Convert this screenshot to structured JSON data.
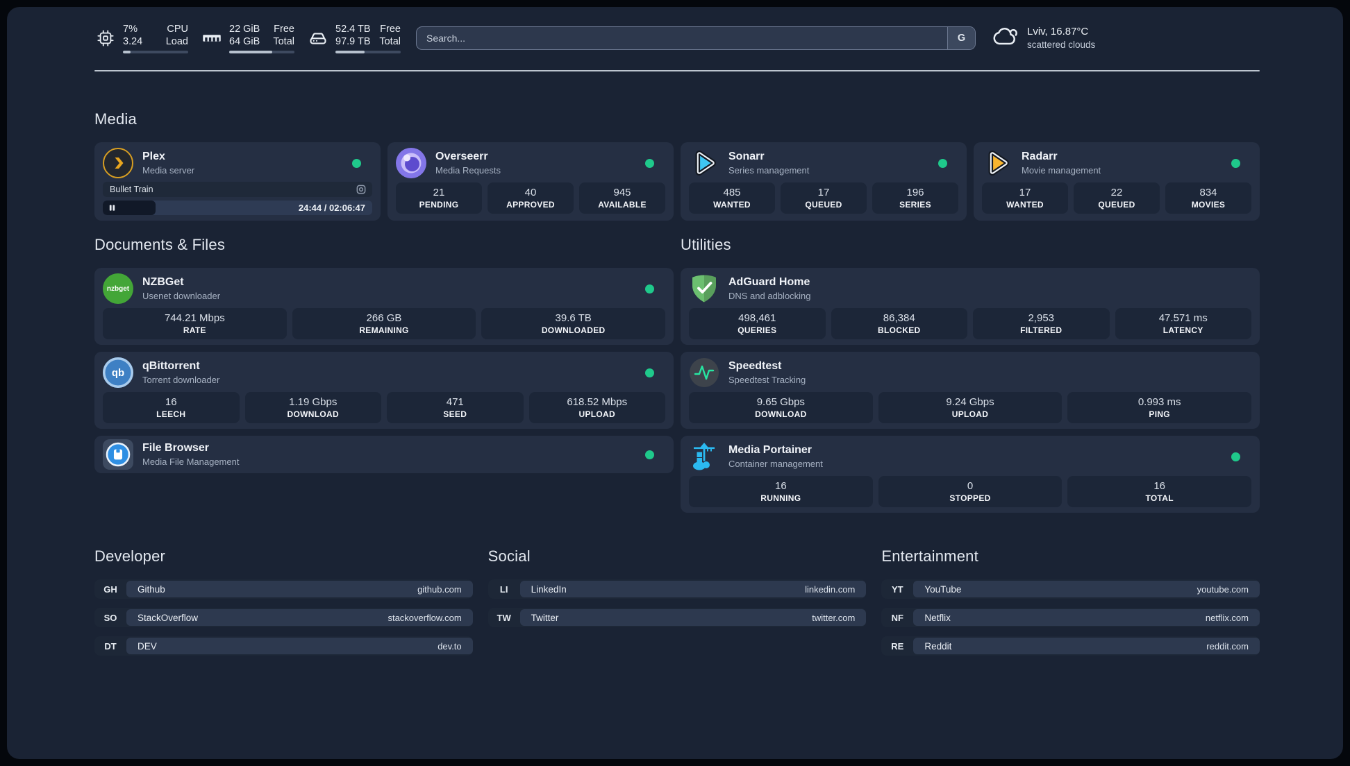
{
  "colors": {
    "status_online": "#1FC98B",
    "accent_cloud_blue": "#2BB9F0"
  },
  "header": {
    "stats": [
      {
        "icon": "cpu-icon",
        "value1": "7%",
        "label1": "CPU",
        "value2": "3.24",
        "label2": "Load",
        "progress_pct": 12
      },
      {
        "icon": "ram-icon",
        "value1": "22 GiB",
        "label1": "Free",
        "value2": "64 GiB",
        "label2": "Total",
        "progress_pct": 66
      },
      {
        "icon": "disk-icon",
        "value1": "52.4 TB",
        "label1": "Free",
        "value2": "97.9 TB",
        "label2": "Total",
        "progress_pct": 45
      }
    ],
    "search": {
      "placeholder": "Search...",
      "engine_label": "G"
    },
    "weather": {
      "icon": "cloud-icon",
      "location": "Lviv, 16.87°C",
      "condition": "scattered clouds"
    }
  },
  "media": {
    "title": "Media",
    "plex": {
      "name": "Plex",
      "subtitle": "Media server",
      "status": "online",
      "now_playing": {
        "title": "Bullet Train",
        "time": "24:44 / 02:06:47",
        "progress_pct": 19.5
      }
    },
    "overseerr": {
      "name": "Overseerr",
      "subtitle": "Media Requests",
      "status": "online",
      "stats": [
        {
          "value": "21",
          "label": "PENDING"
        },
        {
          "value": "40",
          "label": "APPROVED"
        },
        {
          "value": "945",
          "label": "AVAILABLE"
        }
      ]
    },
    "sonarr": {
      "name": "Sonarr",
      "subtitle": "Series management",
      "status": "online",
      "stats": [
        {
          "value": "485",
          "label": "WANTED"
        },
        {
          "value": "17",
          "label": "QUEUED"
        },
        {
          "value": "196",
          "label": "SERIES"
        }
      ]
    },
    "radarr": {
      "name": "Radarr",
      "subtitle": "Movie management",
      "status": "online",
      "stats": [
        {
          "value": "17",
          "label": "WANTED"
        },
        {
          "value": "22",
          "label": "QUEUED"
        },
        {
          "value": "834",
          "label": "MOVIES"
        }
      ]
    }
  },
  "documents": {
    "title": "Documents & Files",
    "nzbget": {
      "name": "NZBGet",
      "subtitle": "Usenet downloader",
      "icon_label": "nzbget",
      "status": "online",
      "stats": [
        {
          "value": "744.21 Mbps",
          "label": "RATE"
        },
        {
          "value": "266 GB",
          "label": "REMAINING"
        },
        {
          "value": "39.6 TB",
          "label": "DOWNLOADED"
        }
      ]
    },
    "qbittorrent": {
      "name": "qBittorrent",
      "subtitle": "Torrent downloader",
      "icon_label": "qb",
      "status": "online",
      "stats": [
        {
          "value": "16",
          "label": "LEECH"
        },
        {
          "value": "1.19 Gbps",
          "label": "DOWNLOAD"
        },
        {
          "value": "471",
          "label": "SEED"
        },
        {
          "value": "618.52 Mbps",
          "label": "UPLOAD"
        }
      ]
    },
    "filebrowser": {
      "name": "File Browser",
      "subtitle": "Media File Management",
      "status": "online"
    }
  },
  "utilities": {
    "title": "Utilities",
    "adguard": {
      "name": "AdGuard Home",
      "subtitle": "DNS and adblocking",
      "stats": [
        {
          "value": "498,461",
          "label": "QUERIES"
        },
        {
          "value": "86,384",
          "label": "BLOCKED"
        },
        {
          "value": "2,953",
          "label": "FILTERED"
        },
        {
          "value": "47.571 ms",
          "label": "LATENCY"
        }
      ]
    },
    "speedtest": {
      "name": "Speedtest",
      "subtitle": "Speedtest Tracking",
      "stats": [
        {
          "value": "9.65 Gbps",
          "label": "DOWNLOAD"
        },
        {
          "value": "9.24 Gbps",
          "label": "UPLOAD"
        },
        {
          "value": "0.993 ms",
          "label": "PING"
        }
      ]
    },
    "portainer": {
      "name": "Media Portainer",
      "subtitle": "Container management",
      "status": "online",
      "stats": [
        {
          "value": "16",
          "label": "RUNNING"
        },
        {
          "value": "0",
          "label": "STOPPED"
        },
        {
          "value": "16",
          "label": "TOTAL"
        }
      ]
    }
  },
  "bookmarks": {
    "developer": {
      "title": "Developer",
      "items": [
        {
          "abbr": "GH",
          "name": "Github",
          "url": "github.com"
        },
        {
          "abbr": "SO",
          "name": "StackOverflow",
          "url": "stackoverflow.com"
        },
        {
          "abbr": "DT",
          "name": "DEV",
          "url": "dev.to"
        }
      ]
    },
    "social": {
      "title": "Social",
      "items": [
        {
          "abbr": "LI",
          "name": "LinkedIn",
          "url": "linkedin.com"
        },
        {
          "abbr": "TW",
          "name": "Twitter",
          "url": "twitter.com"
        }
      ]
    },
    "entertainment": {
      "title": "Entertainment",
      "items": [
        {
          "abbr": "YT",
          "name": "YouTube",
          "url": "youtube.com"
        },
        {
          "abbr": "NF",
          "name": "Netflix",
          "url": "netflix.com"
        },
        {
          "abbr": "RE",
          "name": "Reddit",
          "url": "reddit.com"
        }
      ]
    }
  }
}
